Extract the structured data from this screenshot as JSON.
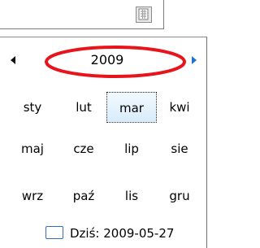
{
  "date_field": {
    "value": ""
  },
  "calendar": {
    "year": "2009",
    "months": [
      "sty",
      "lut",
      "mar",
      "kwi",
      "maj",
      "cze",
      "lip",
      "sie",
      "wrz",
      "paź",
      "lis",
      "gru"
    ],
    "selected_month": "mar",
    "today_label": "Dziś: 2009-05-27"
  },
  "icons": [
    "calendar-icon",
    "chevron-left-icon",
    "chevron-right-icon"
  ],
  "colors": {
    "accent_blue": "#1e73d2",
    "selection_bg": "#d8ecfb",
    "annotation_red": "#e8141c"
  }
}
